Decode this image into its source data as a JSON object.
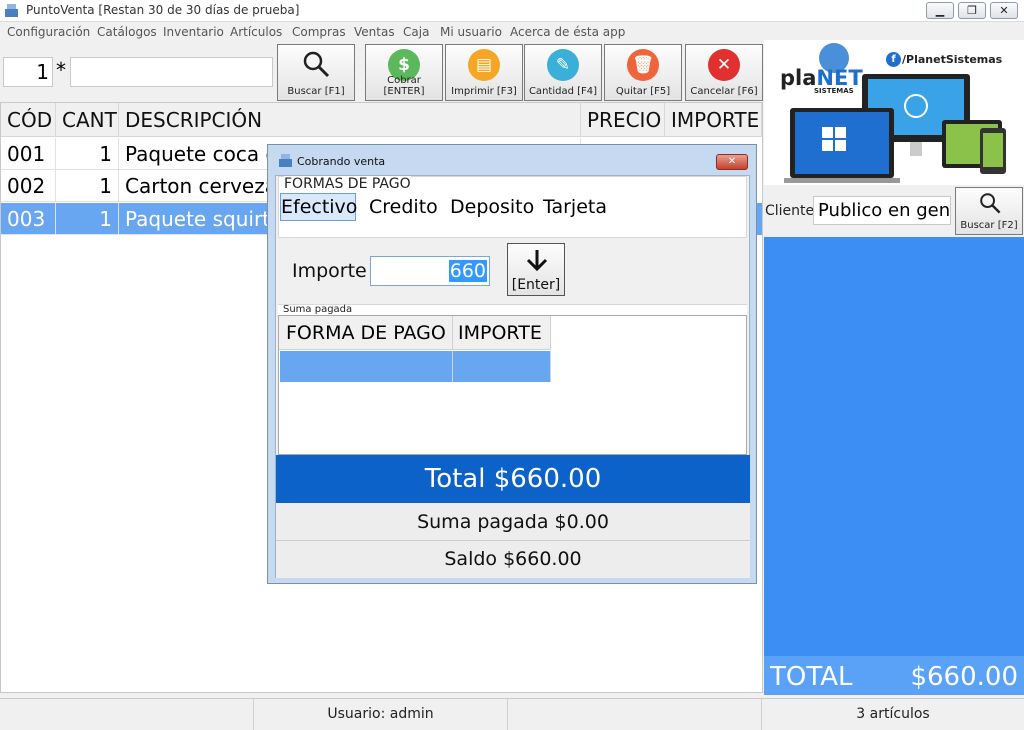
{
  "window": {
    "title": "PuntoVenta [Restan 30 de 30 días de prueba]",
    "min": "▁",
    "max": "❐",
    "close": "✕"
  },
  "menu": [
    "Configuración",
    "Catálogos",
    "Inventario",
    "Artículos",
    "Compras",
    "Ventas",
    "Caja",
    "Mi usuario",
    "Acerca de ésta app"
  ],
  "entry": {
    "quantity": "1",
    "multiplier": "*",
    "code": ""
  },
  "toolbar": {
    "buscar": "Buscar [F1]",
    "cobrar": "Cobrar [ENTER]",
    "imprimir": "Imprimir [F3]",
    "cantidad": "Cantidad [F4]",
    "quitar": "Quitar [F5]",
    "cancelar": "Cancelar [F6]"
  },
  "table": {
    "headers": [
      "CÓD",
      "CANT",
      "DESCRIPCIÓN",
      "PRECIO",
      "IMPORTE"
    ],
    "rows": [
      {
        "cod": "001",
        "cant": "1",
        "desc": "Paquete coca c"
      },
      {
        "cod": "002",
        "cant": "1",
        "desc": "Carton cerveza"
      },
      {
        "cod": "003",
        "cant": "1",
        "desc": "Paquete squirt"
      }
    ]
  },
  "brand": {
    "name_pla": "pla",
    "name_net": "NET",
    "sub": "SISTEMAS",
    "social": "/PlanetSistemas",
    "fb": "f"
  },
  "client": {
    "label": "Cliente",
    "value": "Publico en gene",
    "button": "Buscar [F2]"
  },
  "totals": {
    "label": "TOTAL",
    "value": "$660.00"
  },
  "statusbar": {
    "user": "Usuario: admin",
    "articles": "3 artículos"
  },
  "dialog": {
    "title": "Cobrando venta",
    "close": "✕",
    "group": "FORMAS DE PAGO",
    "tabs": [
      "Efectivo",
      "Credito",
      "Deposito",
      "Tarjeta"
    ],
    "importe_label": "Importe",
    "importe_value": "660",
    "enter_label": "[Enter]",
    "suma_group": "Suma pagada",
    "pay_headers": [
      "FORMA DE PAGO",
      "IMPORTE"
    ],
    "total": "Total $660.00",
    "suma_pagada": "Suma pagada $0.00",
    "saldo": "Saldo $660.00"
  },
  "colors": {
    "accent": "#3c8ef5",
    "total_dark": "#0d62c9",
    "selection": "#69a6f1"
  }
}
